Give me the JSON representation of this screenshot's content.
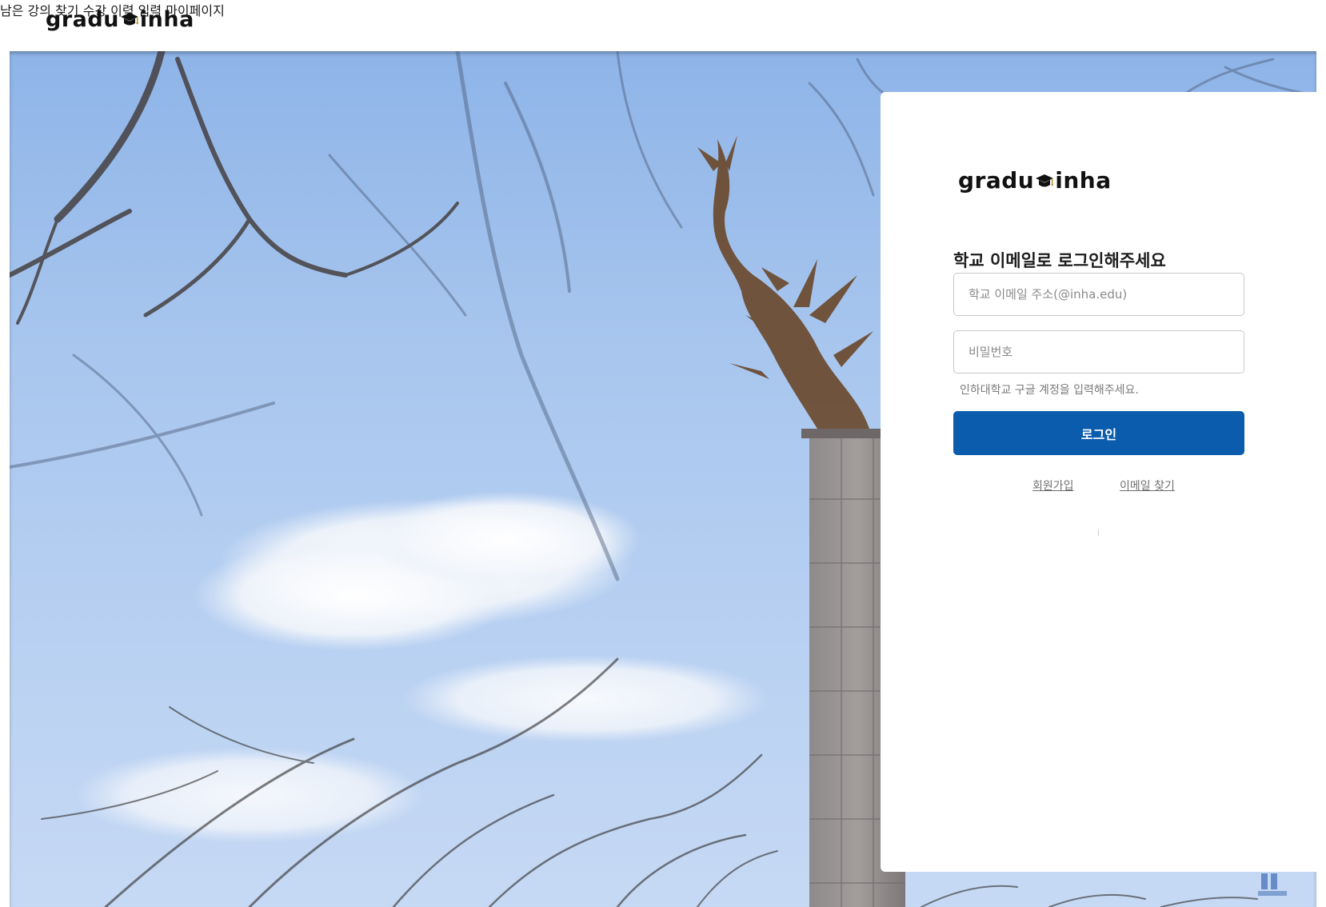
{
  "header": {
    "logo_text_left": "gradu",
    "logo_text_right": "inha",
    "nav": [
      {
        "label": "남은 강의 찾기"
      },
      {
        "label": "수강 이력 입력"
      },
      {
        "label": "마이페이지"
      }
    ]
  },
  "login": {
    "logo_text_left": "gradu",
    "logo_text_right": "inha",
    "title": "학교 이메일로 로그인해주세요",
    "email_placeholder": "학교 이메일 주소(@inha.edu)",
    "email_value": "",
    "password_placeholder": "비밀번호",
    "password_value": "",
    "hint": "인하대학교 구글 계정을 입력해주세요.",
    "submit_label": "로그인",
    "signup_link": "회원가입",
    "find_email_link": "이메일 찾기"
  },
  "colors": {
    "primary": "#0b5cad",
    "sky": "#a8c6ee"
  }
}
